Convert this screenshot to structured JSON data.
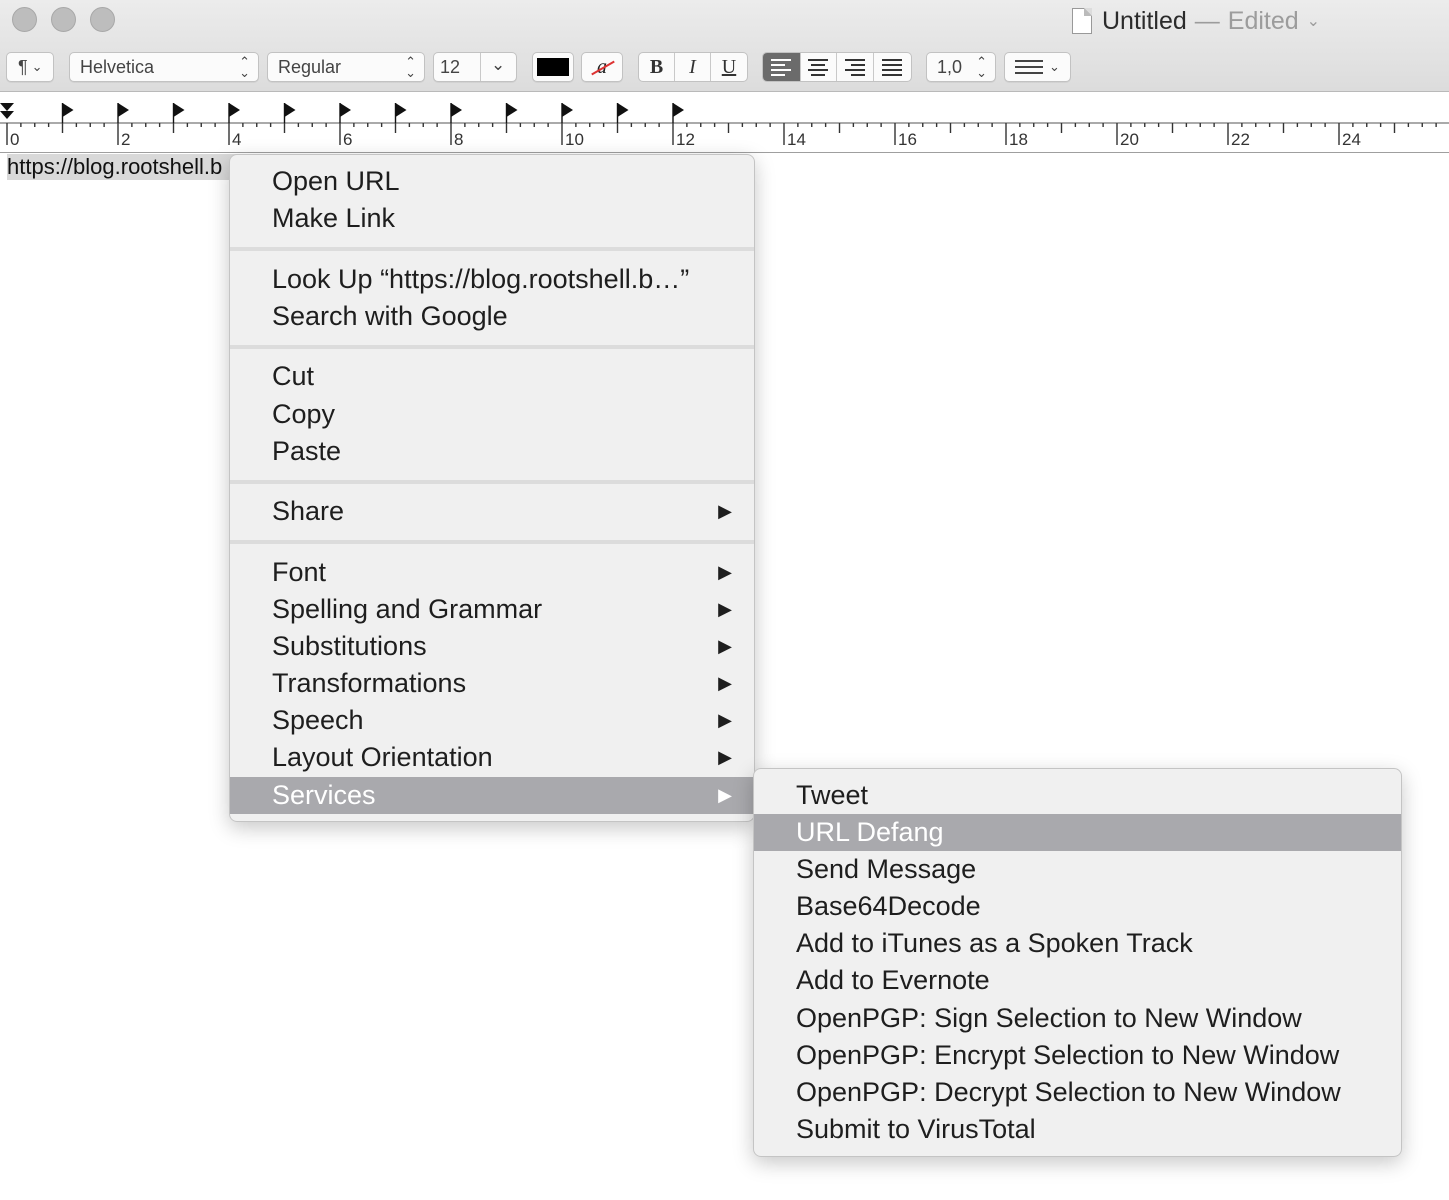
{
  "window": {
    "title": "Untitled",
    "dash": "—",
    "status": "Edited",
    "chevron": "⌄"
  },
  "toolbar": {
    "paragraph_style": "¶",
    "font_family": "Helvetica",
    "font_style": "Regular",
    "font_size": "12",
    "bold": "B",
    "italic": "I",
    "underline": "U",
    "line_spacing": "1,0",
    "text_color": "#000000",
    "highlight_glyph": "a"
  },
  "ruler": {
    "labels": [
      "0",
      "2",
      "4",
      "6",
      "8",
      "10",
      "12",
      "14",
      "16",
      "18",
      "20",
      "22",
      "24"
    ]
  },
  "document": {
    "text": "https://blog.rootshell.b"
  },
  "context_menu": {
    "items": [
      "Open URL",
      "Make Link",
      "Look Up “https://blog.rootshell.b…”",
      "Search with Google",
      "Cut",
      "Copy",
      "Paste",
      "Share",
      "Font",
      "Spelling and Grammar",
      "Substitutions",
      "Transformations",
      "Speech",
      "Layout Orientation",
      "Services"
    ],
    "submenu_arrow": "▶",
    "highlighted": "Services"
  },
  "services_menu": {
    "items": [
      "Tweet",
      "URL Defang",
      "Send Message",
      "Base64Decode",
      "Add to iTunes as a Spoken Track",
      "Add to Evernote",
      "OpenPGP: Sign Selection to New Window",
      "OpenPGP: Encrypt Selection to New Window",
      "OpenPGP: Decrypt Selection to New Window",
      "Submit to VirusTotal"
    ],
    "highlighted": "URL Defang"
  },
  "colors": {
    "menu_highlight": "#a9a9ad",
    "selection": "#d9d9d9"
  }
}
